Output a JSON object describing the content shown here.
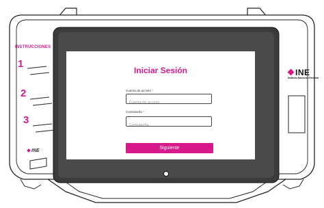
{
  "device": {
    "instructions_label": "INSTRUCCIONES",
    "steps": [
      "1",
      "2",
      "3"
    ],
    "brand": "INE",
    "brand_sub": "Instituto Nacional Electoral",
    "brand_small": "INE"
  },
  "login": {
    "title": "Iniciar Sesión",
    "account_label": "Cuenta de acceso",
    "account_required": "*",
    "account_placeholder": "Cuenta de acceso",
    "account_value": "",
    "password_label": "Contraseña",
    "password_required": "*",
    "password_placeholder": "Contraseña",
    "password_value": "",
    "next_button": "Siguiente"
  },
  "colors": {
    "accent": "#d8198a",
    "outline": "#222222"
  }
}
